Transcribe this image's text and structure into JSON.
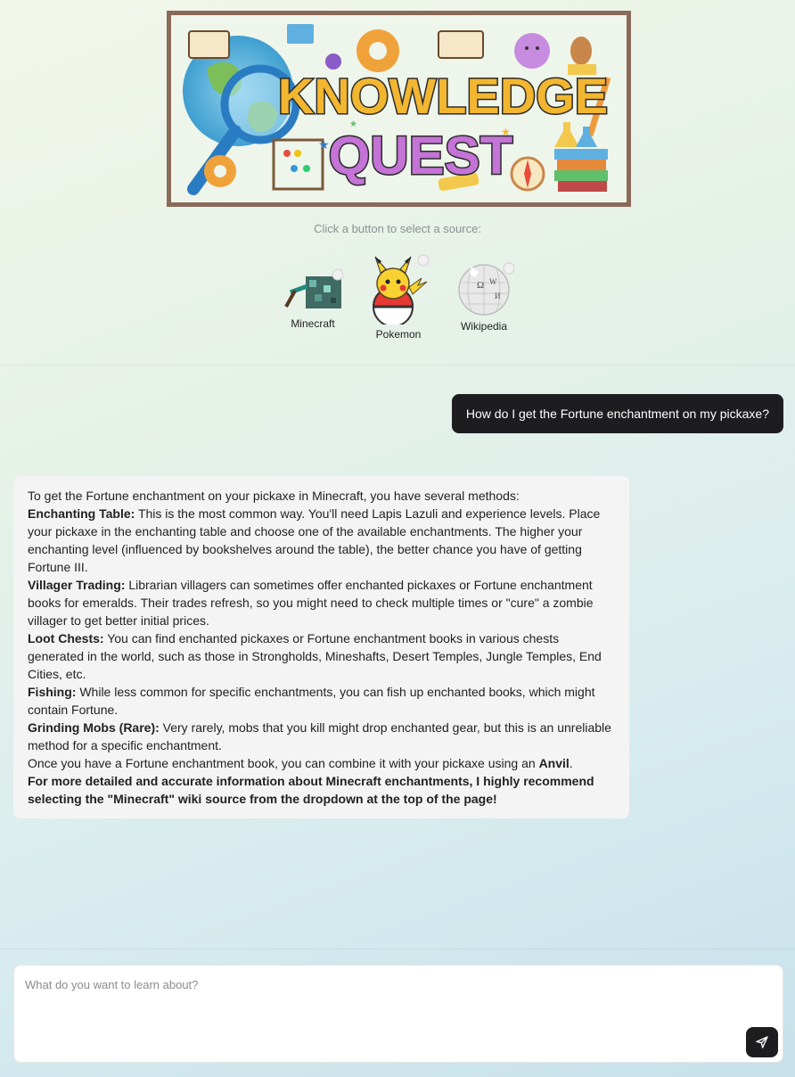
{
  "banner": {
    "line1": "KNOWLEDGE",
    "line2": "QUEST"
  },
  "instruction": "Click a button to select a source:",
  "sources": [
    {
      "label": "Minecraft",
      "icon": "minecraft-pickaxe-icon"
    },
    {
      "label": "Pokemon",
      "icon": "pikachu-pokeball-icon"
    },
    {
      "label": "Wikipedia",
      "icon": "wikipedia-globe-icon"
    }
  ],
  "conversation": {
    "user_message": "How do I get the Fortune enchantment on my pickaxe?",
    "assistant": {
      "intro": "To get the Fortune enchantment on your pickaxe in Minecraft, you have several methods:",
      "methods": [
        {
          "title": "Enchanting Table:",
          "text": "This is the most common way. You'll need Lapis Lazuli and experience levels. Place your pickaxe in the enchanting table and choose one of the available enchantments. The higher your enchanting level (influenced by bookshelves around the table), the better chance you have of getting Fortune III."
        },
        {
          "title": "Villager Trading:",
          "text": "Librarian villagers can sometimes offer enchanted pickaxes or Fortune enchantment books for emeralds. Their trades refresh, so you might need to check multiple times or \"cure\" a zombie villager to get better initial prices."
        },
        {
          "title": "Loot Chests:",
          "text": "You can find enchanted pickaxes or Fortune enchantment books in various chests generated in the world, such as those in Strongholds, Mineshafts, Desert Temples, Jungle Temples, End Cities, etc."
        },
        {
          "title": "Fishing:",
          "text": "While less common for specific enchantments, you can fish up enchanted books, which might contain Fortune."
        },
        {
          "title": "Grinding Mobs (Rare):",
          "text": "Very rarely, mobs that you kill might drop enchanted gear, but this is an unreliable method for a specific enchantment."
        }
      ],
      "anvil_prefix": "Once you have a Fortune enchantment book, you can combine it with your pickaxe using an",
      "anvil_word": "Anvil",
      "anvil_suffix": ".",
      "recommendation": "For more detailed and accurate information about Minecraft enchantments, I highly recommend selecting the \"Minecraft\" wiki source from the dropdown at the top of the page!"
    }
  },
  "composer": {
    "placeholder": "What do you want to learn about?",
    "send_icon": "send-icon"
  },
  "colors": {
    "banner_border": "#8a6a58",
    "user_bubble": "#1d1d1f",
    "bot_bubble": "#f4f4f4"
  }
}
